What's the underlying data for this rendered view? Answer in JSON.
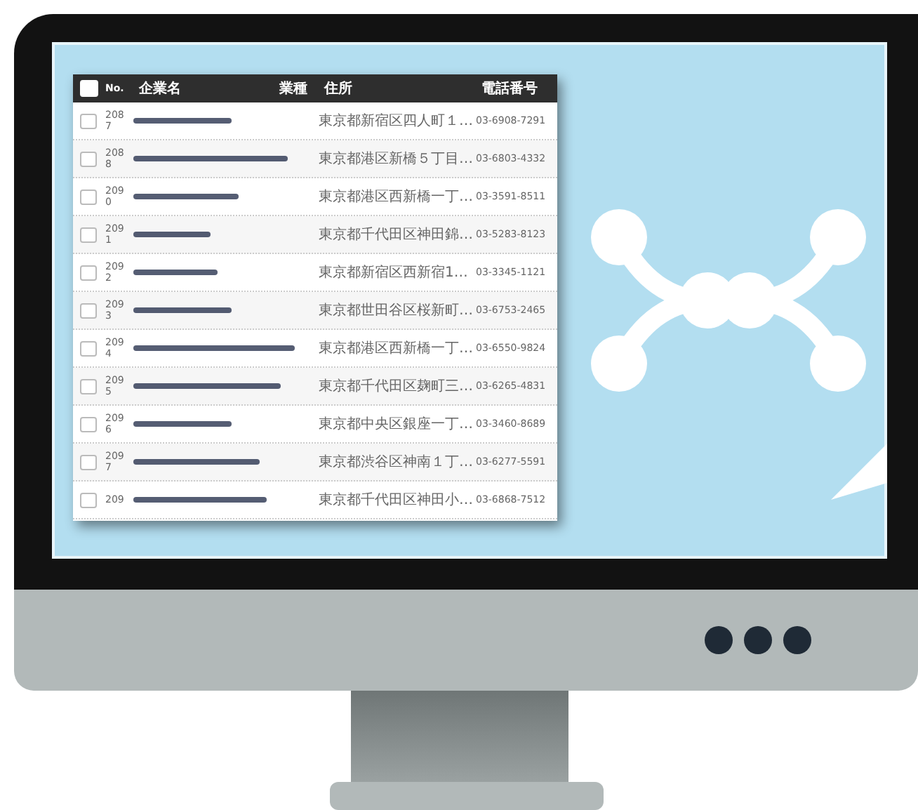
{
  "table": {
    "select_all": {
      "checked": false
    },
    "columns": [
      "No.",
      "企業名",
      "業種",
      "住所",
      "電話番号"
    ],
    "rows": [
      {
        "no": "2087",
        "address": "東京都新宿区四人町１…",
        "phone": "03-6908-7291",
        "checked": false
      },
      {
        "no": "2088",
        "address": "東京都港区新橋５丁目…",
        "phone": "03-6803-4332",
        "checked": false
      },
      {
        "no": "2090",
        "address": "東京都港区西新橋一丁…",
        "phone": "03-3591-8511",
        "checked": false
      },
      {
        "no": "2091",
        "address": "東京都千代田区神田錦…",
        "phone": "03-5283-8123",
        "checked": false
      },
      {
        "no": "2092",
        "address": "東京都新宿区西新宿1…",
        "phone": "03-3345-1121",
        "checked": false
      },
      {
        "no": "2093",
        "address": "東京都世田谷区桜新町…",
        "phone": "03-6753-2465",
        "checked": false
      },
      {
        "no": "2094",
        "address": "東京都港区西新橋一丁…",
        "phone": "03-6550-9824",
        "checked": false
      },
      {
        "no": "2095",
        "address": "東京都千代田区麹町三…",
        "phone": "03-6265-4831",
        "checked": false
      },
      {
        "no": "2096",
        "address": "東京都中央区銀座一丁…",
        "phone": "03-3460-8689",
        "checked": false
      },
      {
        "no": "2097",
        "address": "東京都渋谷区神南１丁…",
        "phone": "03-6277-5591",
        "checked": false
      },
      {
        "no": "209",
        "address": "東京都千代田区神田小…",
        "phone": "03-6868-7512",
        "checked": false
      }
    ]
  }
}
